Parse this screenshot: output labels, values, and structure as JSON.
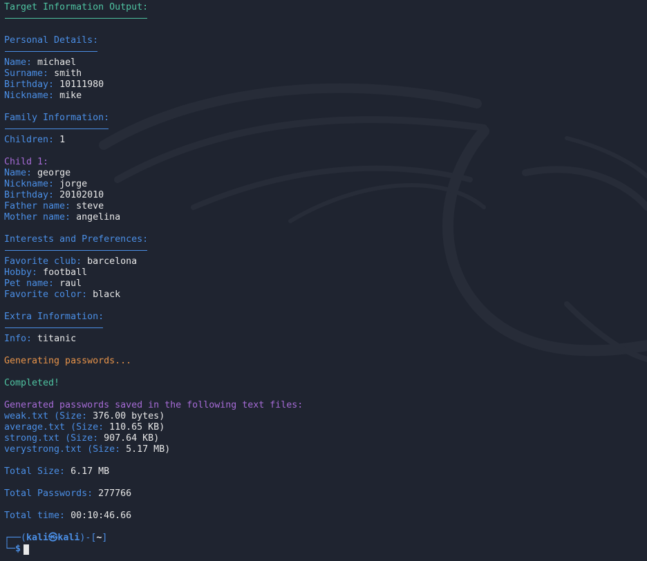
{
  "heading": "Target Information Output:",
  "personal": {
    "title": "Personal Details:",
    "rows": [
      {
        "key": "Name:",
        "value": "michael"
      },
      {
        "key": "Surname:",
        "value": "smith"
      },
      {
        "key": "Birthday:",
        "value": "10111980"
      },
      {
        "key": "Nickname:",
        "value": "mike"
      }
    ]
  },
  "family": {
    "title": "Family Information:",
    "children_key": "Children:",
    "children_value": "1",
    "child_title": "Child 1:",
    "rows": [
      {
        "key": "Name:",
        "value": "george"
      },
      {
        "key": "Nickname:",
        "value": "jorge"
      },
      {
        "key": "Birthday:",
        "value": "20102010"
      },
      {
        "key": "Father name:",
        "value": "steve"
      },
      {
        "key": "Mother name:",
        "value": "angelina"
      }
    ]
  },
  "interests": {
    "title": "Interests and Preferences:",
    "rows": [
      {
        "key": "Favorite club:",
        "value": "barcelona"
      },
      {
        "key": "Hobby:",
        "value": "football"
      },
      {
        "key": "Pet name:",
        "value": "raul"
      },
      {
        "key": "Favorite color:",
        "value": "black"
      }
    ]
  },
  "extra": {
    "title": "Extra Information:",
    "key": "Info:",
    "value": "titanic"
  },
  "status": {
    "generating": "Generating passwords...",
    "completed": "Completed!",
    "saved": "Generated passwords saved in the following text files:"
  },
  "files": [
    {
      "name": "weak.txt",
      "size_label": "(Size:",
      "size": "376.00 bytes",
      "close": ")"
    },
    {
      "name": "average.txt",
      "size_label": "(Size:",
      "size": "110.65 KB",
      "close": ")"
    },
    {
      "name": "strong.txt",
      "size_label": "(Size:",
      "size": "907.64 KB",
      "close": ")"
    },
    {
      "name": "verystrong.txt",
      "size_label": "(Size:",
      "size": "5.17 MB",
      "close": ")"
    }
  ],
  "totals": {
    "size_key": "Total Size:",
    "size_value": "6.17 MB",
    "passwords_key": "Total Passwords:",
    "passwords_value": "277766",
    "time_key": "Total time:",
    "time_value": "00:10:46.66"
  },
  "prompt": {
    "box_start": "┌──(",
    "user": "kali㉿kali",
    "box_mid": ")-[",
    "dir": "~",
    "box_end": "]",
    "line2": "└─",
    "dollar": "$"
  },
  "colors": {
    "background": "#1f2430",
    "teal": "#4fc3a1",
    "blue": "#4b8fe6",
    "purple": "#a66bd6",
    "orange": "#e8944a",
    "text": "#e8e8e8"
  }
}
